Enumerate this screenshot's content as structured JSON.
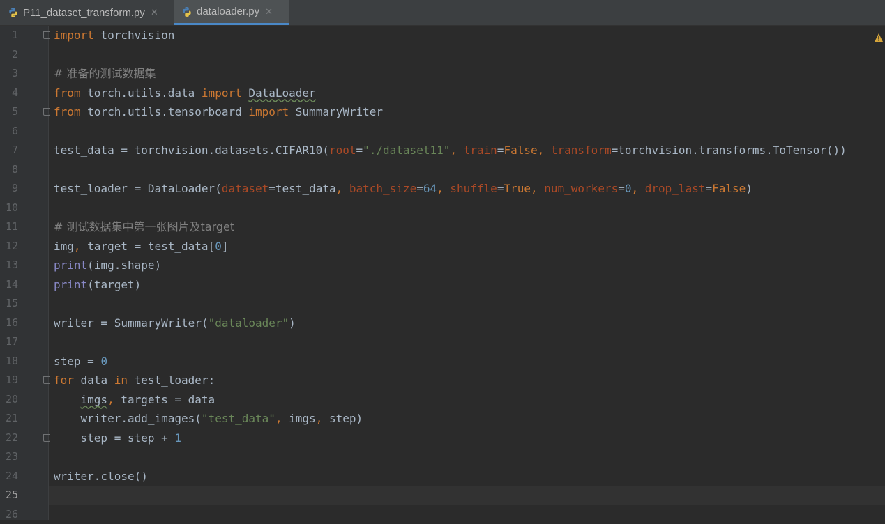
{
  "tabs": [
    {
      "label": "P11_dataset_transform.py",
      "active": false,
      "icon": "python-file-icon"
    },
    {
      "label": "dataloader.py",
      "active": true,
      "icon": "python-file-icon"
    }
  ],
  "colors": {
    "background": "#2b2b2b",
    "keyword": "#cc7832",
    "string": "#6a8759",
    "number": "#6897bb",
    "comment": "#808080",
    "kwarg": "#aa4926",
    "builtin": "#8888c6",
    "text": "#a9b7c6",
    "active_tab_underline": "#4a88c7"
  },
  "editor": {
    "current_line": 25,
    "line_numbers": [
      "1",
      "2",
      "3",
      "4",
      "5",
      "6",
      "7",
      "8",
      "9",
      "10",
      "11",
      "12",
      "13",
      "14",
      "15",
      "16",
      "17",
      "18",
      "19",
      "20",
      "21",
      "22",
      "23",
      "24",
      "25",
      "26"
    ],
    "code": {
      "l1": {
        "kw_import": "import",
        "rest": " torchvision"
      },
      "l3": {
        "comment": "# 准备的测试数据集"
      },
      "l4": {
        "kw_from": "from",
        "mod": " torch.utils.data ",
        "kw_import": "import",
        "sp": " ",
        "name": "DataLoader"
      },
      "l5": {
        "kw_from": "from",
        "mod": " torch.utils.tensorboard ",
        "kw_import": "import",
        "name": " SummaryWriter"
      },
      "l7": {
        "a": "test_data = torchvision.datasets.CIFAR10(",
        "k1": "root",
        "eq1": "=",
        "s1": "\"./dataset11\"",
        "c1": ", ",
        "k2": "train",
        "eq2": "=",
        "v2": "False",
        "c2": ", ",
        "k3": "transform",
        "eq3": "=",
        "tail": "torchvision.transforms.ToTensor())"
      },
      "l9": {
        "a": "test_loader = DataLoader(",
        "k1": "dataset",
        "eq1": "=",
        "v1": "test_data",
        "c1": ", ",
        "k2": "batch_size",
        "eq2": "=",
        "n2": "64",
        "c2": ", ",
        "k3": "shuffle",
        "eq3": "=",
        "v3": "True",
        "c3": ", ",
        "k4": "num_workers",
        "eq4": "=",
        "n4": "0",
        "c4": ", ",
        "k5": "drop_last",
        "eq5": "=",
        "v5": "False",
        "close": ")"
      },
      "l11": {
        "comment": "# 测试数据集中第一张图片及target"
      },
      "l12": {
        "a": "img",
        "c": ", ",
        "b": "target = test_data[",
        "n": "0",
        "close": "]"
      },
      "l13": {
        "bi": "print",
        "rest": "(img.shape)"
      },
      "l14": {
        "bi": "print",
        "rest": "(target)"
      },
      "l16": {
        "a": "writer = SummaryWriter(",
        "s": "\"dataloader\"",
        "close": ")"
      },
      "l18": {
        "a": "step = ",
        "n": "0"
      },
      "l19": {
        "kw_for": "for",
        "a": " data ",
        "kw_in": "in",
        "b": " test_loader:"
      },
      "l20": {
        "indent": "    ",
        "a": "imgs",
        "c": ", ",
        "b": "targets = data"
      },
      "l21": {
        "indent": "    ",
        "a": "writer.add_images(",
        "s": "\"test_data\"",
        "c": ", ",
        "b": "imgs",
        "c2": ", ",
        "d": "step)"
      },
      "l22": {
        "indent": "    ",
        "a": "step = step + ",
        "n": "1"
      },
      "l24": {
        "a": "writer.close()"
      }
    }
  }
}
